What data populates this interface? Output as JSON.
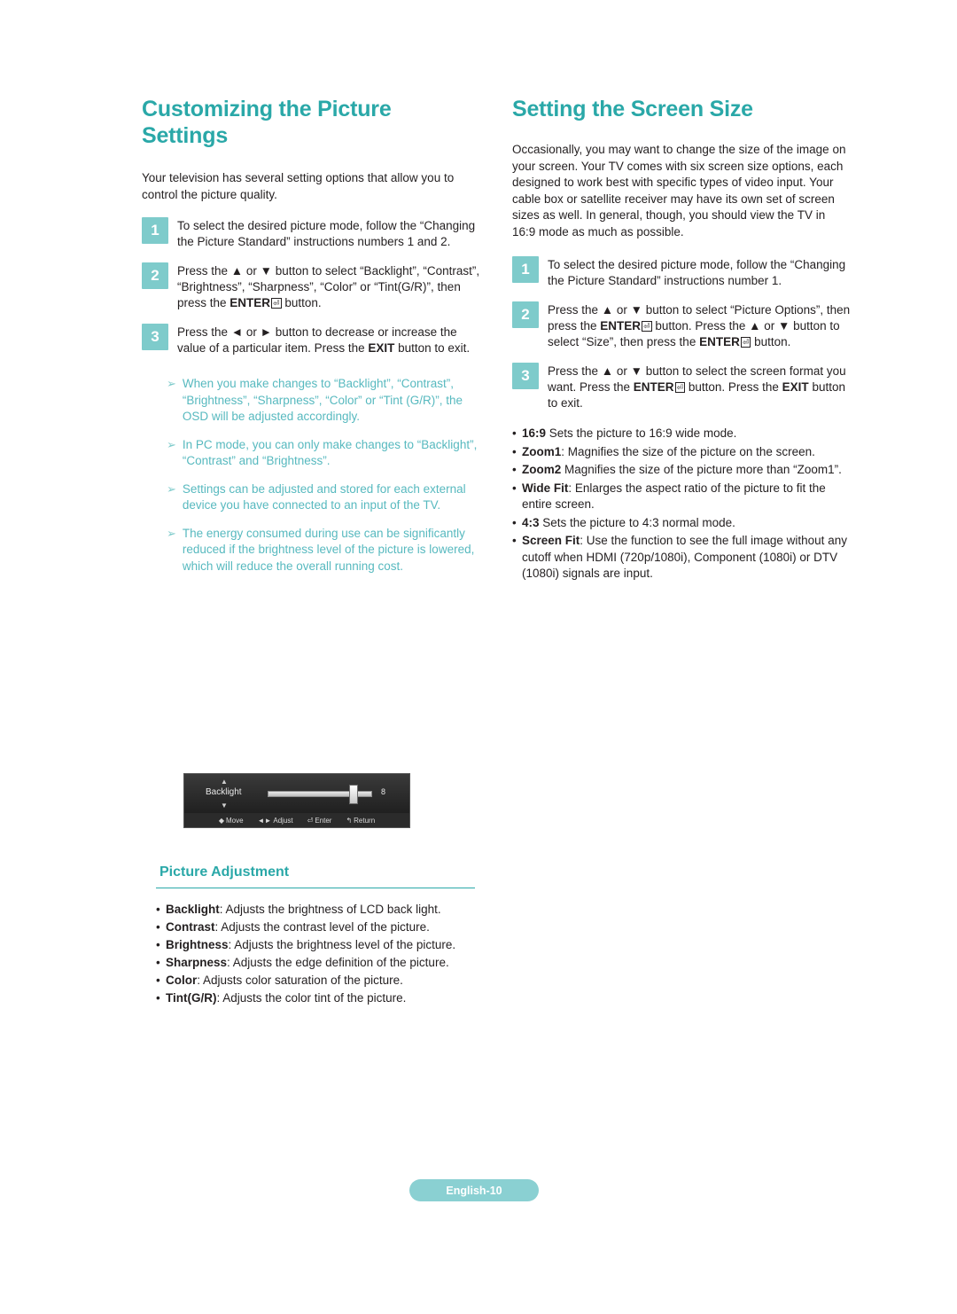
{
  "left": {
    "title": "Customizing the Picture Settings",
    "intro": "Your television has several setting options that allow you to control the picture quality.",
    "steps": [
      {
        "num": "1",
        "text": "To select the desired picture mode, follow the “Changing the Picture Standard” instructions numbers 1 and 2."
      },
      {
        "num": "2",
        "text": "Press the ▲ or ▼ button to select “Backlight”, “Contrast”, “Brightness”, “Sharpness”, “Color” or “Tint(G/R)”, then press the ENTER button."
      },
      {
        "num": "3",
        "text": "Press the ◄ or ► button to decrease or increase the value of a particular item. Press the EXIT button to exit."
      }
    ],
    "notes": [
      "When you make changes to “Backlight”, “Contrast”, “Brightness”, “Sharpness”, “Color” or “Tint (G/R)”, the OSD will be adjusted accordingly.",
      "In PC mode, you can only make changes to “Backlight”, “Contrast” and “Brightness”.",
      "Settings can be adjusted and stored for each external device you have connected to an input of the TV.",
      "The energy consumed during use can be significantly reduced if the brightness level of the picture is lowered, which will reduce the overall running cost."
    ]
  },
  "right": {
    "title": "Setting the Screen Size",
    "intro": "Occasionally, you may want to change the size of the image on your screen. Your TV comes with six screen size options, each designed to work best with specific types of video input. Your cable box or satellite receiver may have its own set of screen sizes as well. In general, though, you should view the TV in 16:9 mode as much as possible.",
    "steps": [
      {
        "num": "1",
        "text": "To select the desired picture mode, follow the “Changing the Picture Standard” instructions number 1."
      },
      {
        "num": "2",
        "text": "Press the ▲ or ▼ button to select “Picture Options”, then press the ENTER button. Press the ▲ or ▼ button to select “Size”, then press the ENTER button."
      },
      {
        "num": "3",
        "text": "Press the ▲ or ▼ button to select the screen format you want. Press the ENTER button. Press the EXIT button to exit."
      }
    ],
    "bullets": [
      {
        "term": "16:9",
        "desc": " Sets the picture to 16:9 wide mode."
      },
      {
        "term": "Zoom1",
        "desc": ": Magnifies the size of the picture on the screen."
      },
      {
        "term": "Zoom2",
        "desc": " Magnifies the size of the picture more than “Zoom1”."
      },
      {
        "term": "Wide Fit",
        "desc": ": Enlarges the aspect ratio of the picture to fit the entire screen."
      },
      {
        "term": "4:3",
        "desc": " Sets the picture to 4:3 normal mode."
      },
      {
        "term": "Screen Fit",
        "desc": ": Use the function to see the full image without any cutoff when HDMI (720p/1080i), Component (1080i) or DTV (1080i) signals are input."
      }
    ]
  },
  "osd": {
    "label": "Backlight",
    "value": "8",
    "footer": [
      {
        "key": "◆",
        "label": "Move"
      },
      {
        "key": "◄►",
        "label": "Adjust"
      },
      {
        "key": "⏎",
        "label": "Enter"
      },
      {
        "key": "↰",
        "label": "Return"
      }
    ]
  },
  "picture_adjustment": {
    "title": "Picture Adjustment",
    "items": [
      {
        "term": "Backlight",
        "desc": ": Adjusts the brightness of LCD back light."
      },
      {
        "term": "Contrast",
        "desc": ": Adjusts the contrast level of the picture."
      },
      {
        "term": "Brightness",
        "desc": ": Adjusts the brightness level of the picture."
      },
      {
        "term": "Sharpness",
        "desc": ": Adjusts the edge definition of the picture."
      },
      {
        "term": "Color",
        "desc": ": Adjusts color saturation of the picture."
      },
      {
        "term": "Tint(G/R)",
        "desc": ": Adjusts the color tint of the picture."
      }
    ]
  },
  "footer": {
    "page_label": "English-10"
  },
  "colors": {
    "accent": "#2aa8a8",
    "note": "#57b9bf",
    "step_badge": "#7ecbcb",
    "footer_pill": "#8ad0d2"
  }
}
